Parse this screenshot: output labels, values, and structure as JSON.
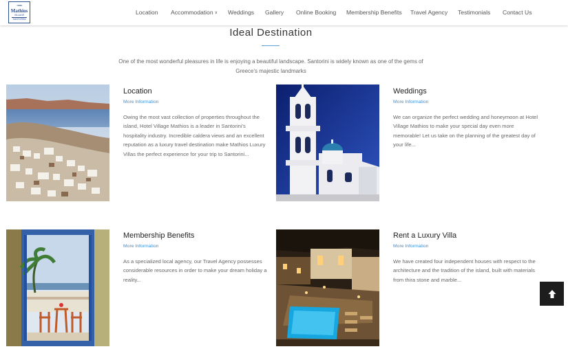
{
  "header": {
    "logo": {
      "brand": "Mathios",
      "sub": "VILLAGE",
      "place": "SANTORINI"
    },
    "nav": [
      {
        "label": "Location"
      },
      {
        "label": "Accommodation",
        "has_dropdown": true
      },
      {
        "label": "Weddings"
      },
      {
        "label": "Gallery"
      },
      {
        "label": "Online Booking"
      },
      {
        "label": "Membership Benefits"
      },
      {
        "label": "Travel Agency"
      },
      {
        "label": "Testimonials"
      },
      {
        "label": "Contact Us"
      }
    ]
  },
  "intro": {
    "title": "Ideal Destination",
    "text": "One of the most wonderful pleasures in life is enjoying a beautiful landscape. Santorini is widely known as one of the gems of Greece's majestic landmarks"
  },
  "cards": [
    {
      "title": "Location",
      "link": "More Information",
      "text": "Owing the most vast collection of properties throughout the island, Hotel Village Mathios is a leader in Santorini's hospitality industry. Incredible caldera views and an excellent reputation as a luxury travel destination make Mathios Luxury Villas the perfect experience for your trip to Santorini..."
    },
    {
      "title": "Weddings",
      "link": "More Information",
      "text": "We can organize the perfect wedding and honeymoon at Hotel Village Mathios to make your special day even more memorable! Let us take on the planning of the greatest day of your life..."
    },
    {
      "title": "Membership Benefits",
      "link": "More Information",
      "text": "As a specialized local agency, our Travel Agency possesses considerable resources in order to make your dream holiday a reality..."
    },
    {
      "title": "Rent a Luxury Villa",
      "link": "More Information",
      "text": "We have created four independent houses with respect to the architecture and the tradition of the island, built with materials from thira stone and marble..."
    }
  ],
  "colors": {
    "accent": "#3a8ed4",
    "logo": "#2a4d8f",
    "to_top_bg": "#1d1d1d"
  },
  "icons": {
    "to_top": "arrow-up-icon",
    "dropdown": "chevron-down-icon"
  }
}
